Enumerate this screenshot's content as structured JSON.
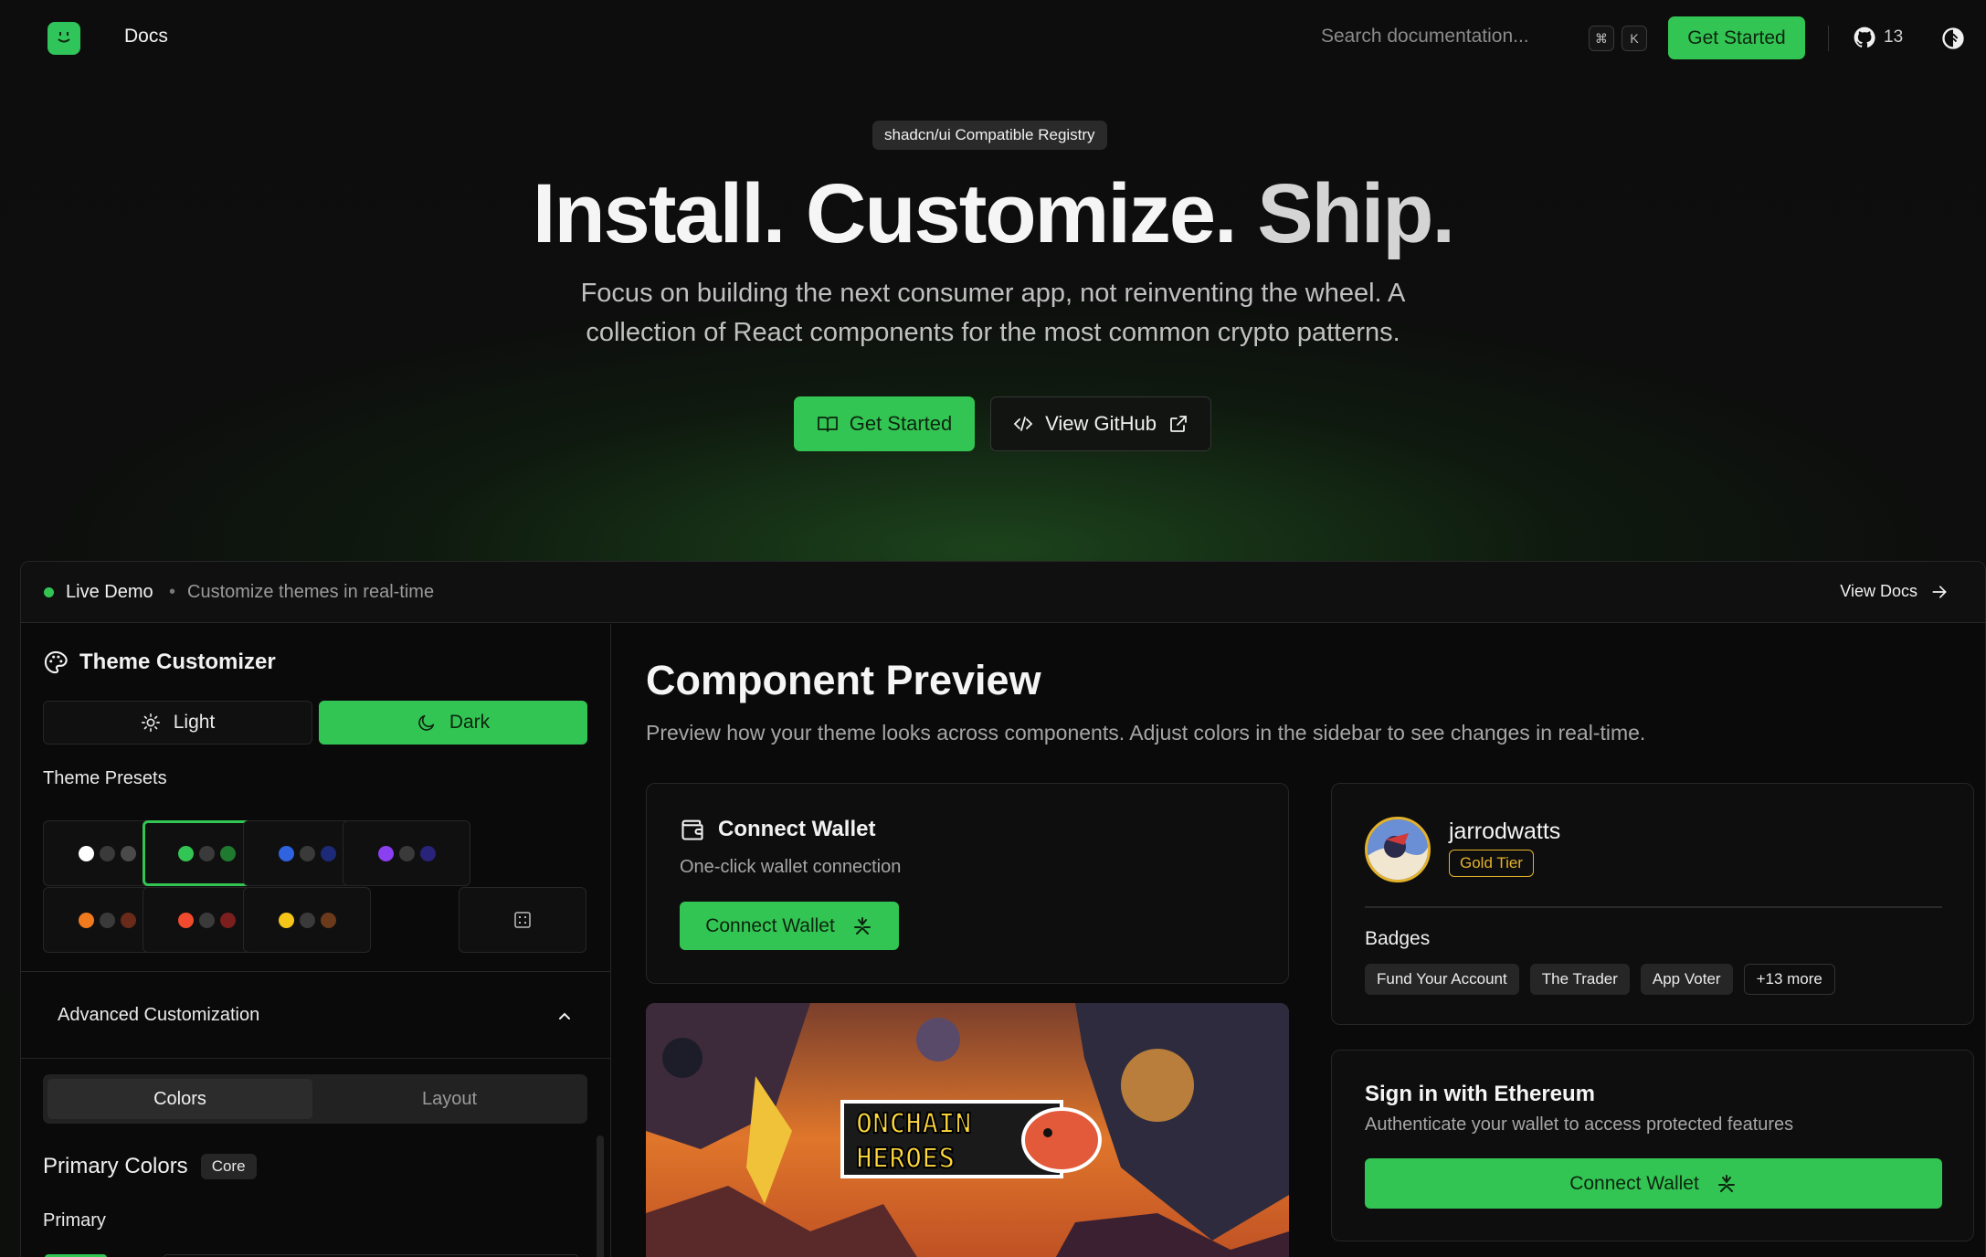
{
  "nav": {
    "docs_label": "Docs",
    "search_placeholder": "Search documentation...",
    "kbd_cmd": "⌘",
    "kbd_k": "K",
    "cta_label": "Get Started",
    "github_stars": "13"
  },
  "hero": {
    "badge": "shadcn/ui Compatible Registry",
    "title_part1": "Install. Customize.",
    "title_part2": "Ship.",
    "subtitle": "Focus on building the next consumer app, not reinventing the wheel. A collection of React components for the most common crypto patterns.",
    "primary_button": "Get Started",
    "secondary_button": "View GitHub"
  },
  "demo": {
    "live_label": "Live Demo",
    "separator": "•",
    "live_sub": "Customize themes in real-time",
    "view_docs": "View Docs"
  },
  "sidebar": {
    "title": "Theme Customizer",
    "mode_light": "Light",
    "mode_dark": "Dark",
    "presets_label": "Theme Presets",
    "presets": [
      {
        "colors": [
          "#ffffff",
          "#3a3a3a",
          "#4a4a4a"
        ],
        "selected": false
      },
      {
        "colors": [
          "#33c553",
          "#3a3a3a",
          "#1f7a30"
        ],
        "selected": true
      },
      {
        "colors": [
          "#2f63e0",
          "#3a3a3a",
          "#1c2a78"
        ],
        "selected": false
      },
      {
        "colors": [
          "#8a3ff0",
          "#3a3a3a",
          "#2a237a"
        ],
        "selected": false
      },
      {
        "colors": [
          "#f07a1e",
          "#3a3a3a",
          "#6a2a1a"
        ],
        "selected": false
      },
      {
        "colors": [
          "#f04b2e",
          "#3a3a3a",
          "#7a1e1e"
        ],
        "selected": false
      },
      {
        "colors": [
          "#f5c518",
          "#3a3a3a",
          "#6a3a1a"
        ],
        "selected": false
      }
    ],
    "advanced_label": "Advanced Customization",
    "tab_colors": "Colors",
    "tab_layout": "Layout",
    "primary_colors_title": "Primary Colors",
    "primary_colors_badge": "Core",
    "primary_label": "Primary"
  },
  "preview": {
    "title": "Component Preview",
    "subtitle": "Preview how your theme looks across components. Adjust colors in the sidebar to see changes in real-time.",
    "wallet_card": {
      "title": "Connect Wallet",
      "subtitle": "One-click wallet connection",
      "button": "Connect Wallet"
    },
    "profile_card": {
      "name": "jarrodwatts",
      "tier": "Gold Tier",
      "badges_label": "Badges",
      "badges": [
        "Fund Your Account",
        "The Trader",
        "App Voter"
      ],
      "more": "+13 more"
    },
    "siwe_card": {
      "title": "Sign in with Ethereum",
      "subtitle": "Authenticate your wallet to access protected features",
      "button": "Connect Wallet"
    },
    "game_banner": {
      "line1": "ONCHAIN",
      "line2": "HEROES"
    }
  },
  "colors": {
    "accent": "#33c553",
    "gold": "#e3b12a",
    "background": "#0b0b0b"
  }
}
